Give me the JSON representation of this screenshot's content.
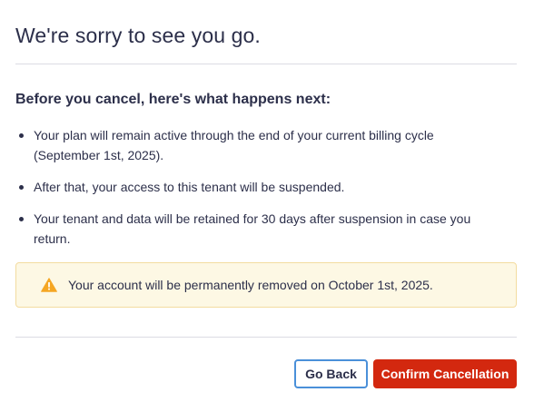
{
  "dialog": {
    "title": "We're sorry to see you go.",
    "subtitle": "Before you cancel, here's what happens next:",
    "items": [
      "Your plan will remain active through the end of your current billing cycle (September 1st, 2025).",
      "After that, your access to this tenant will be suspended.",
      "Your tenant and data will be retained for 30 days after suspension in case you return."
    ],
    "warning": {
      "icon": "warning-triangle-icon",
      "text": "Your account will be permanently removed on October 1st, 2025.",
      "color": "#f5a623",
      "background": "#fdf8e4"
    },
    "buttons": {
      "back_label": "Go Back",
      "confirm_label": "Confirm Cancellation"
    },
    "colors": {
      "danger": "#d3280f",
      "focus_border": "#4a90d9"
    }
  }
}
